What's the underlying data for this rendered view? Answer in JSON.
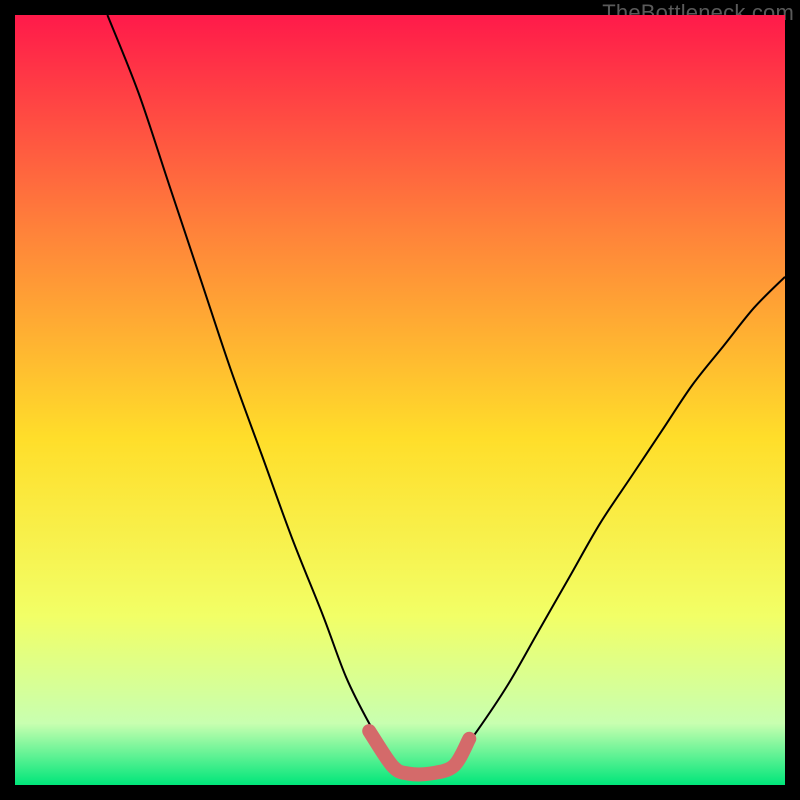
{
  "watermark": "TheBottleneck.com",
  "chart_data": {
    "type": "line",
    "title": "",
    "xlabel": "",
    "ylabel": "",
    "xlim": [
      0,
      100
    ],
    "ylim": [
      0,
      100
    ],
    "grid": false,
    "legend": false,
    "series": [
      {
        "name": "left-curve",
        "color": "#000000",
        "x": [
          12,
          16,
          20,
          24,
          28,
          32,
          36,
          40,
          43,
          46,
          49
        ],
        "values": [
          100,
          90,
          78,
          66,
          54,
          43,
          32,
          22,
          14,
          8,
          3
        ]
      },
      {
        "name": "right-curve",
        "color": "#000000",
        "x": [
          57,
          60,
          64,
          68,
          72,
          76,
          80,
          84,
          88,
          92,
          96,
          100
        ],
        "values": [
          3,
          7,
          13,
          20,
          27,
          34,
          40,
          46,
          52,
          57,
          62,
          66
        ]
      },
      {
        "name": "valley-highlight",
        "color": "#d46a6a",
        "x": [
          46,
          49,
          51,
          54,
          57,
          59
        ],
        "values": [
          7,
          2.5,
          1.5,
          1.5,
          2.5,
          6
        ]
      }
    ],
    "background_gradient": {
      "top": "#ff1a4a",
      "upper_mid": "#ff823a",
      "mid": "#ffde2a",
      "lower_mid": "#f2ff66",
      "near_bottom": "#c8ffb0",
      "bottom": "#00e67a"
    }
  }
}
